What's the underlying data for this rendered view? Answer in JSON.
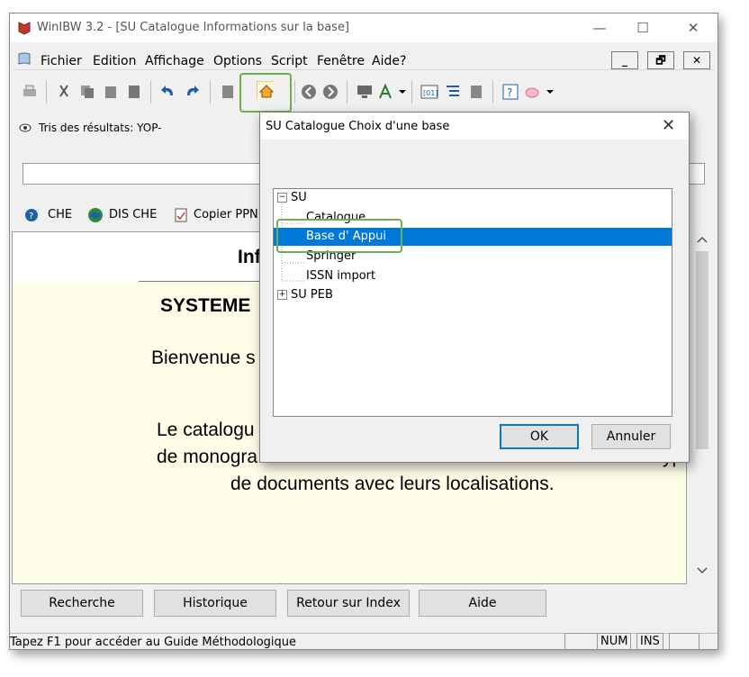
{
  "window": {
    "title": "WinIBW 3.2 - [SU Catalogue Informations sur la base]",
    "minimize": "—",
    "maximize": "☐",
    "close": "✕"
  },
  "menubar": {
    "items": [
      "Fichier",
      "Edition",
      "Affichage",
      "Options",
      "Script",
      "Fenêtre",
      "Aide?"
    ],
    "mdi_minimize": "_",
    "mdi_restore": "🗗",
    "mdi_close": "✕"
  },
  "info": {
    "sort_label": "Tris des résultats: YOP-"
  },
  "linkbar": {
    "che": "CHE",
    "dis_che": "DIS CHE",
    "copier": "Copier PPN"
  },
  "content": {
    "heading": "Inf",
    "systeme": "SYSTEME",
    "bienvenue": "Bienvenue s",
    "line1": "Le catalogu",
    "line2": "de monogra",
    "line2_tail": "yp",
    "line3": "de documents avec leurs localisations."
  },
  "bottom_buttons": [
    "Recherche",
    "Historique",
    "Retour sur Index",
    "Aide"
  ],
  "statusbar": {
    "hint": "Tapez F1 pour accéder au Guide Méthodologique",
    "num": "NUM",
    "ins": "INS"
  },
  "dialog": {
    "title": "SU Catalogue Choix d'une base",
    "close": "✕",
    "tree": {
      "root": "SU",
      "children": [
        "Catalogue",
        "Base d' Appui",
        "Springer",
        "ISSN import"
      ],
      "selected": "Base d' Appui",
      "root2": "SU PEB"
    },
    "ok": "OK",
    "cancel": "Annuler"
  },
  "colors": {
    "selection": "#0078d7",
    "highlight": "#6ab04c",
    "content_bg": "#fefde8"
  }
}
